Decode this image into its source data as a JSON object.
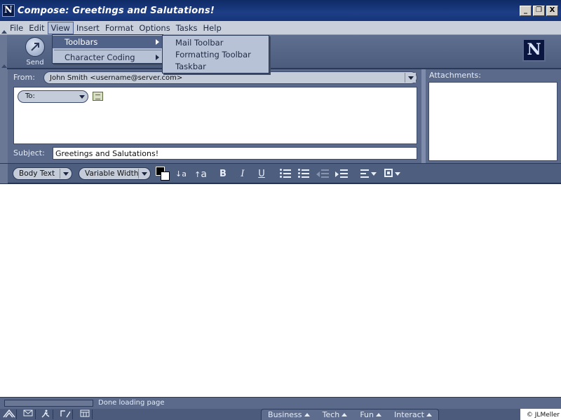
{
  "window": {
    "title": "Compose: Greetings and Salutations!",
    "icon_letter": "N",
    "minimize_glyph": "_",
    "restore_glyph": "❐",
    "close_glyph": "X"
  },
  "menubar": {
    "items": [
      "File",
      "Edit",
      "View",
      "Insert",
      "Format",
      "Options",
      "Tasks",
      "Help"
    ],
    "active": "View"
  },
  "view_menu": {
    "items": [
      {
        "label": "Toolbars",
        "has_submenu": true,
        "highlighted": true
      },
      {
        "label": "Character Coding",
        "has_submenu": true,
        "highlighted": false
      }
    ]
  },
  "toolbars_submenu": {
    "items": [
      "Mail Toolbar",
      "Formatting Toolbar",
      "Taskbar"
    ]
  },
  "toolbar": {
    "send_label": "Send",
    "logo_letter": "N"
  },
  "compose": {
    "from_label": "From:",
    "from_value": "John Smith <username@server.com>",
    "to_label": "To:",
    "subject_label": "Subject:",
    "subject_value": "Greetings and Salutations!",
    "attachments_label": "Attachments:"
  },
  "formatting": {
    "paragraph_style": "Body Text",
    "font_face": "Variable Width",
    "text_color": "#000000",
    "background_color": "#ffffff",
    "decrease_font_label": "a",
    "increase_font_label": "a",
    "bold_label": "B",
    "italic_label": "I",
    "underline_label": "U"
  },
  "status": {
    "text": "Done loading page"
  },
  "taskbar": {
    "tabs": [
      "Business",
      "Tech",
      "Fun",
      "Interact"
    ],
    "copyright": "© JLMeller"
  },
  "colors": {
    "accent": "#516289",
    "chrome": "#5b6a8a",
    "titlebar": "#16357a"
  }
}
